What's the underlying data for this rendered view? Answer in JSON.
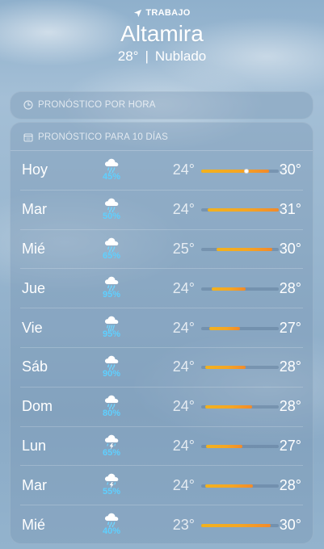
{
  "header": {
    "location_label": "TRABAJO",
    "city": "Altamira",
    "temp": "28°",
    "separator": "|",
    "condition": "Nublado"
  },
  "hourly": {
    "title": "PRONÓSTICO POR HORA",
    "icon": "clock-icon"
  },
  "daily": {
    "title": "PRONÓSTICO PARA 10 DÍAS",
    "icon": "calendar-icon",
    "days": [
      {
        "day": "Hoy",
        "icon": "cloud-rain-icon",
        "precip": "45%",
        "low": "24°",
        "high": "30°",
        "bar_start": 0.0,
        "bar_end": 0.88,
        "current": 0.58
      },
      {
        "day": "Mar",
        "icon": "cloud-rain-icon",
        "precip": "50%",
        "low": "24°",
        "high": "31°",
        "bar_start": 0.08,
        "bar_end": 1.0
      },
      {
        "day": "Mié",
        "icon": "cloud-rain-icon",
        "precip": "65%",
        "low": "25°",
        "high": "30°",
        "bar_start": 0.2,
        "bar_end": 0.92
      },
      {
        "day": "Jue",
        "icon": "cloud-rain-icon",
        "precip": "95%",
        "low": "24°",
        "high": "28°",
        "bar_start": 0.14,
        "bar_end": 0.58
      },
      {
        "day": "Vie",
        "icon": "cloud-heavy-rain-icon",
        "precip": "95%",
        "low": "24°",
        "high": "27°",
        "bar_start": 0.1,
        "bar_end": 0.5
      },
      {
        "day": "Sáb",
        "icon": "cloud-rain-icon",
        "precip": "90%",
        "low": "24°",
        "high": "28°",
        "bar_start": 0.05,
        "bar_end": 0.57
      },
      {
        "day": "Dom",
        "icon": "cloud-rain-icon",
        "precip": "80%",
        "low": "24°",
        "high": "28°",
        "bar_start": 0.05,
        "bar_end": 0.65
      },
      {
        "day": "Lun",
        "icon": "cloud-bolt-rain-icon",
        "precip": "65%",
        "low": "24°",
        "high": "27°",
        "bar_start": 0.06,
        "bar_end": 0.53
      },
      {
        "day": "Mar",
        "icon": "cloud-bolt-rain-icon",
        "precip": "55%",
        "low": "24°",
        "high": "28°",
        "bar_start": 0.05,
        "bar_end": 0.66
      },
      {
        "day": "Mié",
        "icon": "cloud-rain-icon",
        "precip": "40%",
        "low": "23°",
        "high": "30°",
        "bar_start": 0.0,
        "bar_end": 0.9
      }
    ]
  },
  "colors": {
    "precip": "#5fd0ff",
    "bar_start": "#f2b21e",
    "bar_end": "#f28a2a"
  }
}
